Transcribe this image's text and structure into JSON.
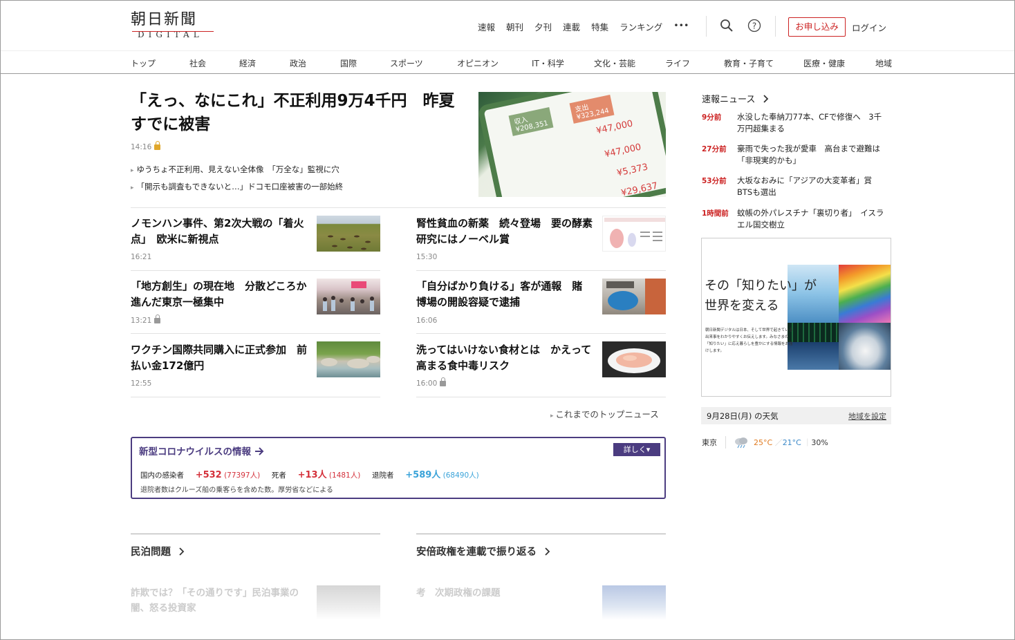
{
  "header": {
    "logo_main": "朝日新聞",
    "logo_sub": "DIGITAL",
    "top_links": [
      "速報",
      "朝刊",
      "夕刊",
      "連載",
      "特集",
      "ランキング",
      "•••"
    ],
    "signup_label": "お申し込み",
    "login_label": "ログイン"
  },
  "section_nav": [
    "トップ",
    "社会",
    "経済",
    "政治",
    "国際",
    "スポーツ",
    "オピニオン",
    "IT・科学",
    "文化・芸能",
    "ライフ",
    "教育・子育て",
    "医療・健康",
    "地域"
  ],
  "lead": {
    "title": "「えっ、なにこれ」不正利用9万4千円　昨夏すでに被害",
    "time": "14:16",
    "related": [
      "ゆうちょ不正利用、見えない全体像　「万全な」監視に穴",
      "「開示も調査もできないと…」ドコモ口座被害の一部始終"
    ],
    "image_labels": {
      "income": "収入",
      "income_amount": "¥208,351",
      "expense": "支出",
      "expense_amount": "¥323,244",
      "amounts": [
        "¥47,000",
        "¥47,000",
        "¥5,373",
        "¥29,637"
      ]
    }
  },
  "articles_left": [
    {
      "title": "ノモンハン事件、第2次大戦の「着火点」　欧米に新視点",
      "time": "16:21"
    },
    {
      "title": "「地方創生」の現在地　分散どころか進んだ東京一極集中",
      "time": "13:21"
    },
    {
      "title": "ワクチン国際共同購入に正式参加　前払い金172億円",
      "time": "12:55"
    }
  ],
  "articles_right": [
    {
      "title": "腎性貧血の新薬　続々登場　要の酵素研究にはノーベル賞",
      "time": "15:30"
    },
    {
      "title": "「自分ばかり負ける」客が通報　賭博場の開設容疑で逮捕",
      "time": "16:06"
    },
    {
      "title": "洗ってはいけない食材とは　かえって高まる食中毒リスク",
      "time": "16:00"
    }
  ],
  "more_top_news": "これまでのトップニュース",
  "corona": {
    "title": "新型コロナウイルスの情報",
    "button": "詳しく▾",
    "infected_label": "国内の感染者",
    "infected_new": "+532",
    "infected_total": "(77397人)",
    "deaths_label": "死者",
    "deaths_new": "+13人",
    "deaths_total": "(1481人)",
    "discharged_label": "退院者",
    "discharged_new": "+589人",
    "discharged_total": "(68490人)",
    "note": "退院者数はクルーズ船の乗客らを含めた数。厚労省などによる"
  },
  "lower_sections": {
    "left_title": "民泊問題",
    "left_article": "詐欺では？「その通りです」民泊事業の闇、怒る投資家",
    "right_title": "安倍政権を連載で振り返る",
    "right_article": "考　次期政権の課題"
  },
  "sokuhou": {
    "title": "速報ニュース",
    "items": [
      {
        "time": "9分前",
        "text": "水没した奉納刀77本、CFで修復へ　3千万円超集まる"
      },
      {
        "time": "27分前",
        "text": "豪雨で失った我が愛車　高台まで避難は「非現実的かも」"
      },
      {
        "time": "53分前",
        "text": "大坂なおみに「アジアの大変革者」賞　BTSも選出"
      },
      {
        "time": "1時間前",
        "text": "蚊帳の外パレスチナ「裏切り者」　イスラエル国交樹立"
      }
    ]
  },
  "ad": {
    "headline_1": "その「知りたい」が",
    "headline_2": "世界を変える",
    "body": "朝日新聞デジタルは日本、そして世界で起きている出来事をわかりやすくお伝えします。みなさまの「知りたい」に応え暮らしを豊かにする情報をお届けします。"
  },
  "weather": {
    "date": "9月28日(月) の天気",
    "set_region": "地域を設定",
    "city": "東京",
    "high": "25°C",
    "low": "21°C",
    "rain": "30%"
  },
  "colors": {
    "brand_red": "#cc2222",
    "corona_purple": "#4b3c80",
    "corona_red": "#d4303a",
    "corona_blue": "#3aa3d9"
  }
}
